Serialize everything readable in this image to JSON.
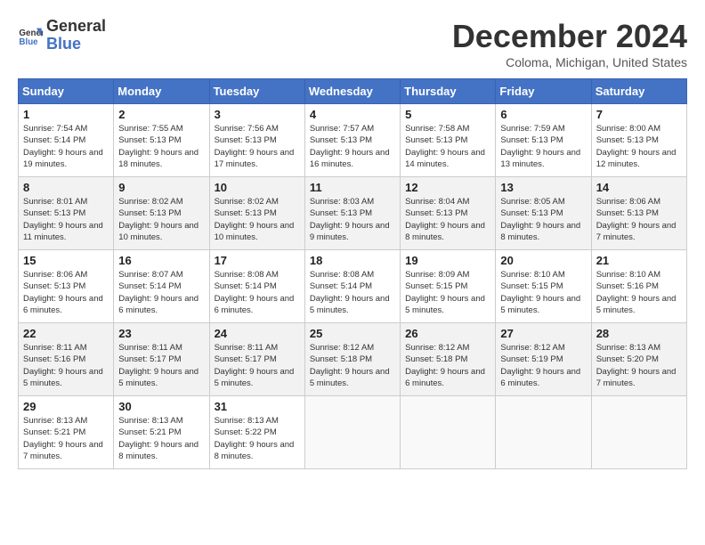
{
  "header": {
    "logo_line1": "General",
    "logo_line2": "Blue",
    "month": "December 2024",
    "location": "Coloma, Michigan, United States"
  },
  "days_of_week": [
    "Sunday",
    "Monday",
    "Tuesday",
    "Wednesday",
    "Thursday",
    "Friday",
    "Saturday"
  ],
  "weeks": [
    [
      {
        "day": "1",
        "sunrise": "7:54 AM",
        "sunset": "5:14 PM",
        "daylight": "9 hours and 19 minutes."
      },
      {
        "day": "2",
        "sunrise": "7:55 AM",
        "sunset": "5:13 PM",
        "daylight": "9 hours and 18 minutes."
      },
      {
        "day": "3",
        "sunrise": "7:56 AM",
        "sunset": "5:13 PM",
        "daylight": "9 hours and 17 minutes."
      },
      {
        "day": "4",
        "sunrise": "7:57 AM",
        "sunset": "5:13 PM",
        "daylight": "9 hours and 16 minutes."
      },
      {
        "day": "5",
        "sunrise": "7:58 AM",
        "sunset": "5:13 PM",
        "daylight": "9 hours and 14 minutes."
      },
      {
        "day": "6",
        "sunrise": "7:59 AM",
        "sunset": "5:13 PM",
        "daylight": "9 hours and 13 minutes."
      },
      {
        "day": "7",
        "sunrise": "8:00 AM",
        "sunset": "5:13 PM",
        "daylight": "9 hours and 12 minutes."
      }
    ],
    [
      {
        "day": "8",
        "sunrise": "8:01 AM",
        "sunset": "5:13 PM",
        "daylight": "9 hours and 11 minutes."
      },
      {
        "day": "9",
        "sunrise": "8:02 AM",
        "sunset": "5:13 PM",
        "daylight": "9 hours and 10 minutes."
      },
      {
        "day": "10",
        "sunrise": "8:02 AM",
        "sunset": "5:13 PM",
        "daylight": "9 hours and 10 minutes."
      },
      {
        "day": "11",
        "sunrise": "8:03 AM",
        "sunset": "5:13 PM",
        "daylight": "9 hours and 9 minutes."
      },
      {
        "day": "12",
        "sunrise": "8:04 AM",
        "sunset": "5:13 PM",
        "daylight": "9 hours and 8 minutes."
      },
      {
        "day": "13",
        "sunrise": "8:05 AM",
        "sunset": "5:13 PM",
        "daylight": "9 hours and 8 minutes."
      },
      {
        "day": "14",
        "sunrise": "8:06 AM",
        "sunset": "5:13 PM",
        "daylight": "9 hours and 7 minutes."
      }
    ],
    [
      {
        "day": "15",
        "sunrise": "8:06 AM",
        "sunset": "5:13 PM",
        "daylight": "9 hours and 6 minutes."
      },
      {
        "day": "16",
        "sunrise": "8:07 AM",
        "sunset": "5:14 PM",
        "daylight": "9 hours and 6 minutes."
      },
      {
        "day": "17",
        "sunrise": "8:08 AM",
        "sunset": "5:14 PM",
        "daylight": "9 hours and 6 minutes."
      },
      {
        "day": "18",
        "sunrise": "8:08 AM",
        "sunset": "5:14 PM",
        "daylight": "9 hours and 5 minutes."
      },
      {
        "day": "19",
        "sunrise": "8:09 AM",
        "sunset": "5:15 PM",
        "daylight": "9 hours and 5 minutes."
      },
      {
        "day": "20",
        "sunrise": "8:10 AM",
        "sunset": "5:15 PM",
        "daylight": "9 hours and 5 minutes."
      },
      {
        "day": "21",
        "sunrise": "8:10 AM",
        "sunset": "5:16 PM",
        "daylight": "9 hours and 5 minutes."
      }
    ],
    [
      {
        "day": "22",
        "sunrise": "8:11 AM",
        "sunset": "5:16 PM",
        "daylight": "9 hours and 5 minutes."
      },
      {
        "day": "23",
        "sunrise": "8:11 AM",
        "sunset": "5:17 PM",
        "daylight": "9 hours and 5 minutes."
      },
      {
        "day": "24",
        "sunrise": "8:11 AM",
        "sunset": "5:17 PM",
        "daylight": "9 hours and 5 minutes."
      },
      {
        "day": "25",
        "sunrise": "8:12 AM",
        "sunset": "5:18 PM",
        "daylight": "9 hours and 5 minutes."
      },
      {
        "day": "26",
        "sunrise": "8:12 AM",
        "sunset": "5:18 PM",
        "daylight": "9 hours and 6 minutes."
      },
      {
        "day": "27",
        "sunrise": "8:12 AM",
        "sunset": "5:19 PM",
        "daylight": "9 hours and 6 minutes."
      },
      {
        "day": "28",
        "sunrise": "8:13 AM",
        "sunset": "5:20 PM",
        "daylight": "9 hours and 7 minutes."
      }
    ],
    [
      {
        "day": "29",
        "sunrise": "8:13 AM",
        "sunset": "5:21 PM",
        "daylight": "9 hours and 7 minutes."
      },
      {
        "day": "30",
        "sunrise": "8:13 AM",
        "sunset": "5:21 PM",
        "daylight": "9 hours and 8 minutes."
      },
      {
        "day": "31",
        "sunrise": "8:13 AM",
        "sunset": "5:22 PM",
        "daylight": "9 hours and 8 minutes."
      },
      null,
      null,
      null,
      null
    ]
  ],
  "labels": {
    "sunrise": "Sunrise:",
    "sunset": "Sunset:",
    "daylight": "Daylight:"
  }
}
